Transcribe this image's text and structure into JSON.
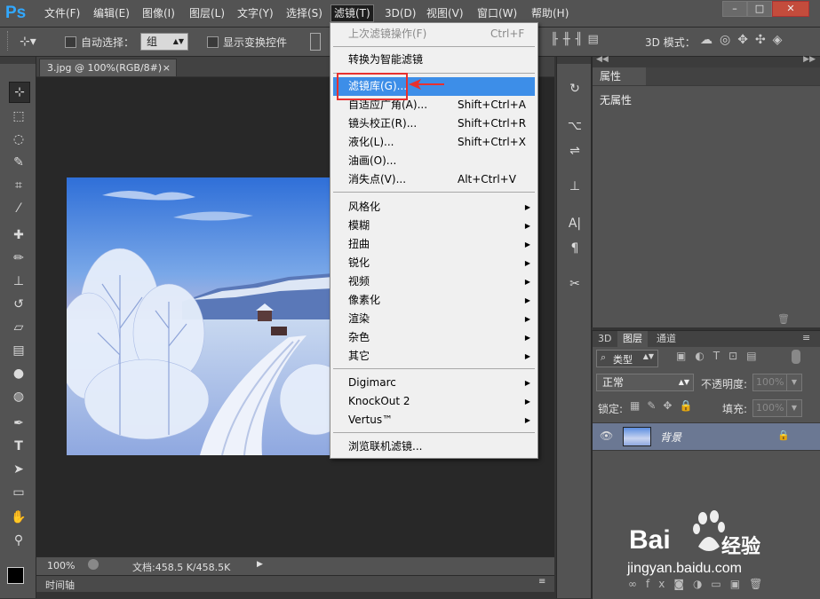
{
  "app": {
    "logo": "Ps"
  },
  "menubar": {
    "items": [
      "文件(F)",
      "编辑(E)",
      "图像(I)",
      "图层(L)",
      "文字(Y)",
      "选择(S)",
      "滤镜(T)",
      "3D(D)",
      "视图(V)",
      "窗口(W)",
      "帮助(H)"
    ],
    "active": "滤镜(T)",
    "window_buttons": [
      "–",
      "□",
      "✕"
    ]
  },
  "options_bar": {
    "auto_select_label": "自动选择：",
    "auto_select_value": "组",
    "show_transform_label": "显示变换控件",
    "mode_3d_label": "3D 模式："
  },
  "document": {
    "tab_title": "3.jpg @ 100%(RGB/8#)",
    "tab_close": "×",
    "zoom": "100%",
    "doc_info": "文档:458.5 K/458.5K",
    "timeline_label": "时间轴"
  },
  "properties_panel": {
    "tab": "属性",
    "content": "无属性"
  },
  "layers_panel": {
    "tabs": [
      "3D",
      "图层",
      "通道"
    ],
    "active_tab": "图层",
    "filter_kind": "类型",
    "blend_mode": "正常",
    "opacity_label": "不透明度:",
    "opacity_value": "100%",
    "lock_label": "锁定:",
    "fill_label": "填充:",
    "fill_value": "100%",
    "layer_name": "背景"
  },
  "filter_menu": {
    "items": [
      {
        "label": "上次滤镜操作(F)",
        "shortcut": "Ctrl+F",
        "disabled": true
      },
      {
        "label": "转换为智能滤镜"
      },
      {
        "label": "滤镜库(G)...",
        "highlighted": true
      },
      {
        "label": "自适应广角(A)...",
        "shortcut": "Shift+Ctrl+A"
      },
      {
        "label": "镜头校正(R)...",
        "shortcut": "Shift+Ctrl+R"
      },
      {
        "label": "液化(L)...",
        "shortcut": "Shift+Ctrl+X"
      },
      {
        "label": "油画(O)..."
      },
      {
        "label": "消失点(V)...",
        "shortcut": "Alt+Ctrl+V"
      },
      {
        "label": "风格化",
        "submenu": true
      },
      {
        "label": "模糊",
        "submenu": true
      },
      {
        "label": "扭曲",
        "submenu": true
      },
      {
        "label": "锐化",
        "submenu": true
      },
      {
        "label": "视频",
        "submenu": true
      },
      {
        "label": "像素化",
        "submenu": true
      },
      {
        "label": "渲染",
        "submenu": true
      },
      {
        "label": "杂色",
        "submenu": true
      },
      {
        "label": "其它",
        "submenu": true
      },
      {
        "label": "Digimarc",
        "submenu": true
      },
      {
        "label": "KnockOut 2",
        "submenu": true
      },
      {
        "label": "Vertus™",
        "submenu": true
      },
      {
        "label": "浏览联机滤镜..."
      }
    ]
  },
  "watermark": {
    "brand": "Bai",
    "brand_suffix": "经验",
    "url": "jingyan.baidu.com"
  },
  "colors": {
    "accent": "#3d8ee8",
    "ps_blue": "#31a8ff",
    "annotation_red": "#e8302e"
  }
}
